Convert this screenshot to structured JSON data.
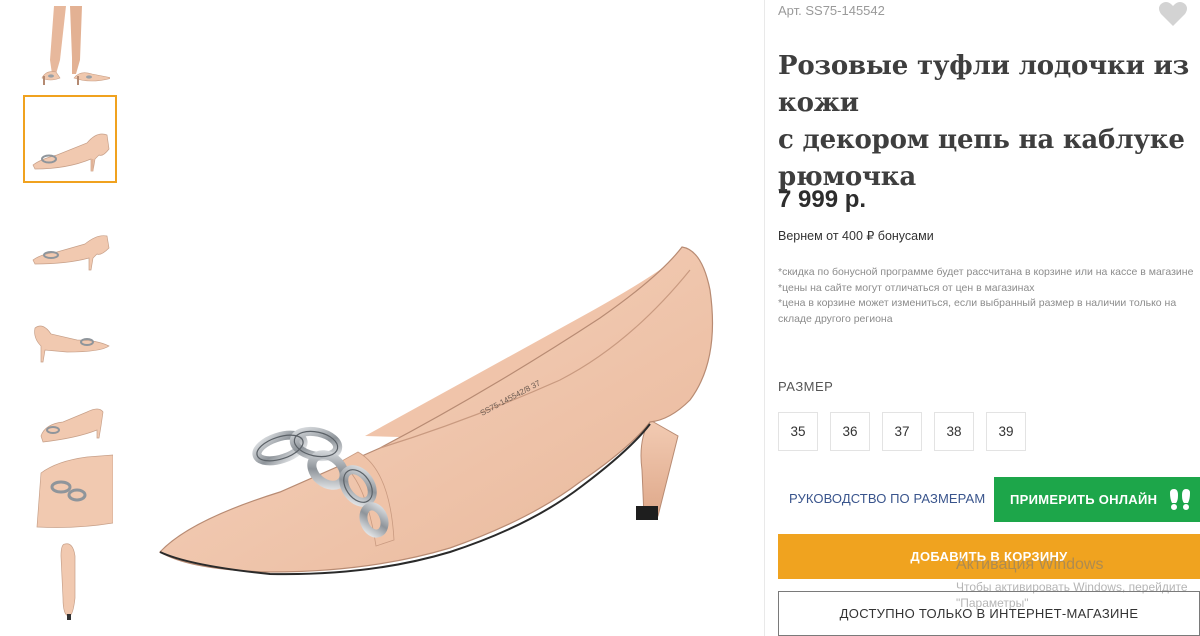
{
  "product": {
    "article": "Арт. SS75-145542",
    "title_lines": [
      "Розовые туфли лодочки из кожи",
      "с декором цепь на каблуке",
      "рюмочка"
    ],
    "price": "7 999 р.",
    "bonus": "Вернем от 400 ₽ бонусами",
    "notes": [
      "*скидка по бонусной программе будет рассчитана в корзине или на кассе в магазине",
      "*цены на сайте могут отличаться от цен в магазинах",
      "*цена в корзине может измениться, если выбранный размер в наличии только на складе другого региона"
    ],
    "insole_print": "SS75-145542/8 37"
  },
  "sizes": {
    "label": "РАЗМЕР",
    "options": [
      "35",
      "36",
      "37",
      "38",
      "39"
    ]
  },
  "actions": {
    "size_guide": "РУКОВОДСТВО ПО РАЗМЕРАМ",
    "try_online": "ПРИМЕРИТЬ ОНЛАЙН",
    "add_to_cart": "ДОБАВИТЬ В КОРЗИНУ",
    "online_only": "ДОСТУПНО ТОЛЬКО В ИНТЕРНЕТ-МАГАЗИНЕ"
  },
  "gallery": {
    "thumbnail_count": 7,
    "active_index": 1
  },
  "overlay": {
    "line1": "Активация Windows",
    "line2": "Чтобы активировать Windows, перейдите",
    "line3": "\"Параметры\""
  },
  "colors": {
    "accent_orange": "#f0a31f",
    "try_green": "#1da64a",
    "link_blue": "#39548c",
    "shoe_nude": "#f1c9b0"
  },
  "icons": [
    "heart-icon",
    "feet-icon"
  ]
}
